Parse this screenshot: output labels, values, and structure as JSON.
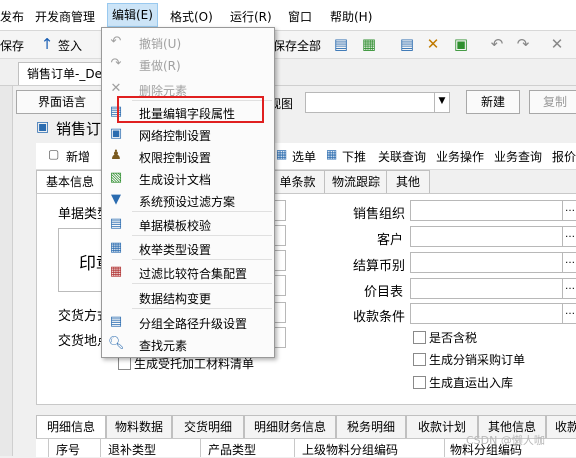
{
  "menubar": {
    "items": [
      "发布",
      "开发商管理",
      "编辑(E)",
      "格式(O)",
      "运行(R)",
      "窗口",
      "帮助(H)"
    ],
    "active_index": 2
  },
  "toolbar": {
    "save": "保存",
    "checkin": "签入",
    "save_all": "保存全部"
  },
  "doc_tab": {
    "title": "销售订单-_Def"
  },
  "row2": {
    "ui_lang": "界面语言",
    "view": "视图",
    "new_button": "新建",
    "copy_button": "复制"
  },
  "card_title": "销售订",
  "subtoolbar": {
    "add": "新增",
    "select_order": "选单",
    "push_down": "下推",
    "related_query": "关联查询",
    "biz_op": "业务操作",
    "biz_query": "业务查询",
    "report": "报价"
  },
  "form_tabs": {
    "basic": "基本信息",
    "terms": "单条款",
    "logistics": "物流跟踪",
    "other": "其他"
  },
  "form_left": {
    "doc_type": "单据类型",
    "stamp": "印章",
    "delivery_mode": "交货方式",
    "delivery_place": "交货地点",
    "generate_outsourcing": "生成受托加工材料清单"
  },
  "form_right": {
    "sales_org": "销售组织",
    "customer": "客户",
    "currency": "结算币别",
    "price_list": "价目表",
    "payment_terms": "收款条件",
    "tax_included": "是否含税",
    "gen_purchase": "生成分销采购订单",
    "gen_direct": "生成直运出入库"
  },
  "edit_menu": {
    "items": [
      {
        "label": "撤销(U)",
        "icon": "undo-icon",
        "disabled": true
      },
      {
        "label": "重做(R)",
        "icon": "redo-icon",
        "disabled": true
      },
      {
        "label": "删除元素",
        "icon": "delete-icon",
        "disabled": true
      },
      {
        "label": "批量编辑字段属性",
        "icon": "batch-edit-icon",
        "disabled": false
      },
      {
        "label": "网络控制设置",
        "icon": "network-icon",
        "disabled": false
      },
      {
        "label": "权限控制设置",
        "icon": "permission-icon",
        "disabled": false
      },
      {
        "label": "生成设计文档",
        "icon": "doc-icon",
        "disabled": false
      },
      {
        "label": "系统预设过滤方案",
        "icon": "filter-icon",
        "disabled": false
      },
      {
        "label": "单据模板校验",
        "icon": "template-check-icon",
        "disabled": false
      },
      {
        "label": "枚举类型设置",
        "icon": "enum-icon",
        "disabled": false
      },
      {
        "label": "过滤比较符合集配置",
        "icon": "compare-icon",
        "disabled": false
      },
      {
        "label": "数据结构变更",
        "icon": "data-structure-icon",
        "disabled": false
      },
      {
        "label": "分组全路径升级设置",
        "icon": "group-path-icon",
        "disabled": false
      },
      {
        "label": "查找元素",
        "icon": "search-icon",
        "disabled": false
      }
    ]
  },
  "bottom_tabs": [
    "明细信息",
    "物料数据",
    "交货明细",
    "明细财务信息",
    "税务明细",
    "收款计划",
    "其他信息",
    "收款"
  ],
  "grid_headers": [
    "序号",
    "退补类型",
    "产品类型",
    "上级物料分组编码",
    "物料分组编码"
  ],
  "watermark": "CSDN @懒人咖"
}
